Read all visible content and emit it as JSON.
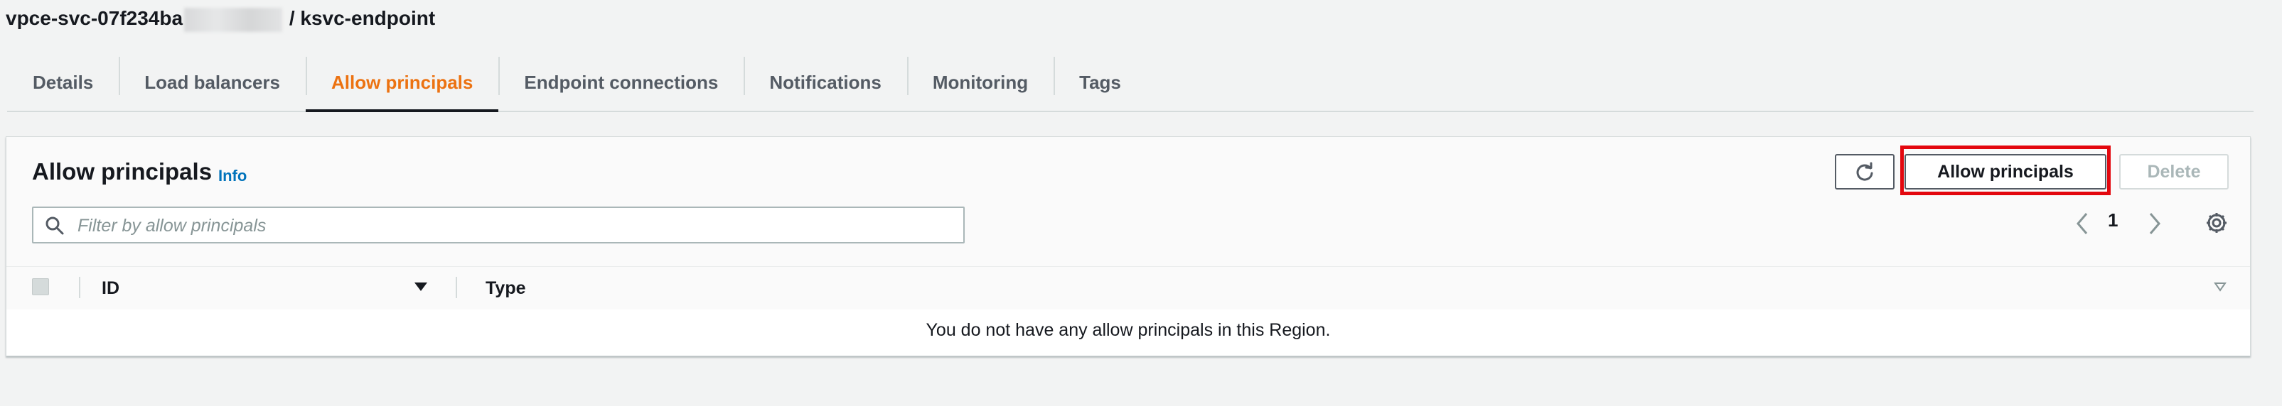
{
  "page": {
    "title_prefix": "vpce-svc-07f234ba",
    "title_suffix": "/ ksvc-endpoint"
  },
  "tabs": [
    {
      "label": "Details"
    },
    {
      "label": "Load balancers"
    },
    {
      "label": "Allow principals",
      "active": true
    },
    {
      "label": "Endpoint connections"
    },
    {
      "label": "Notifications"
    },
    {
      "label": "Monitoring"
    },
    {
      "label": "Tags"
    }
  ],
  "panel": {
    "title": "Allow principals",
    "info_link": "Info",
    "refresh_icon": "refresh-icon",
    "allow_button": "Allow principals",
    "delete_button": "Delete",
    "search_placeholder": "Filter by allow principals",
    "page_number": "1"
  },
  "table": {
    "columns": [
      "ID",
      "Type"
    ],
    "rows": [],
    "empty_message": "You do not have any allow principals in this Region."
  },
  "colors": {
    "active_tab": "#ec7211",
    "link": "#0073bb",
    "highlight": "#e3070e"
  }
}
